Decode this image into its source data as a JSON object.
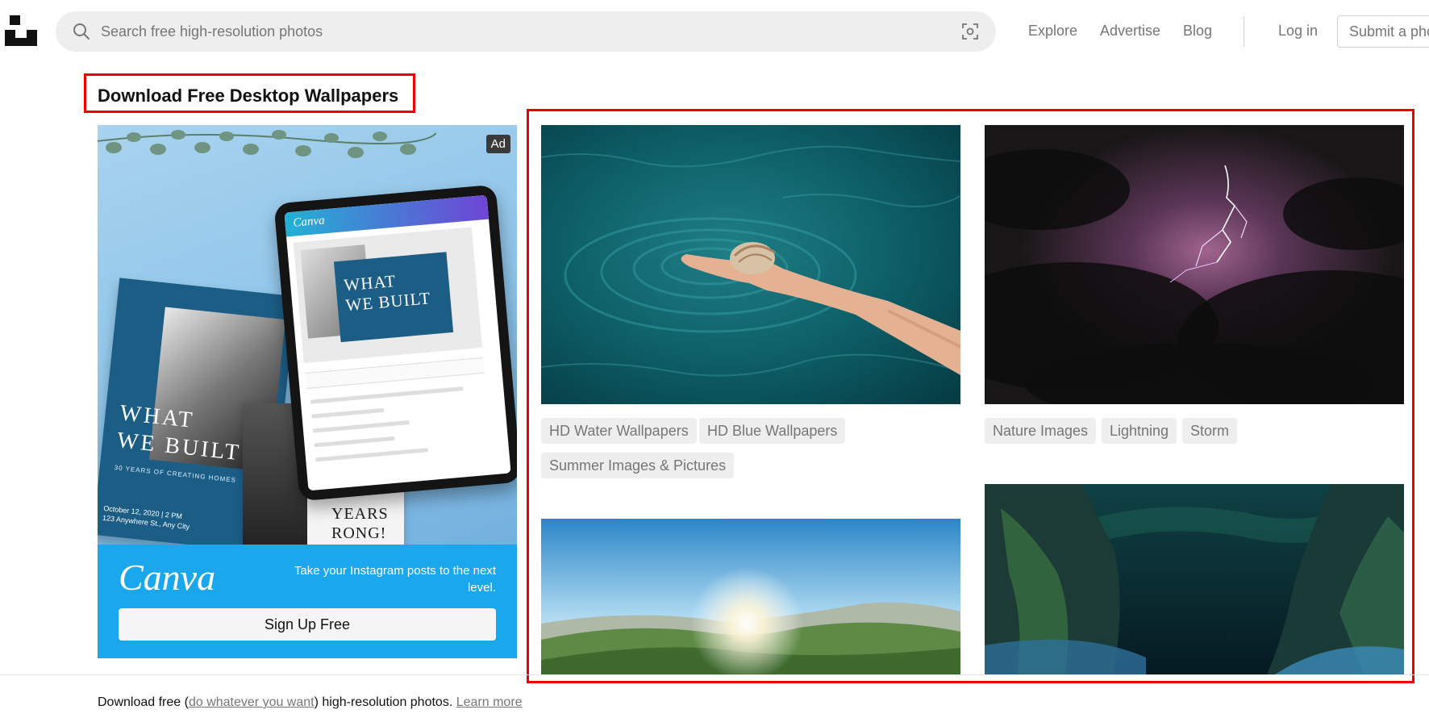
{
  "header": {
    "search_placeholder": "Search free high-resolution photos",
    "nav": {
      "explore": "Explore",
      "advertise": "Advertise",
      "blog": "Blog",
      "login": "Log in"
    },
    "submit_label": "Submit a photo"
  },
  "page_title": "Download Free Desktop Wallpapers",
  "ad": {
    "badge": "Ad",
    "poster_title_line1": "WHAT",
    "poster_title_line2": "WE BUILT",
    "poster_subtitle": "30 YEARS OF CREATING HOMES",
    "poster_date_line1": "October 12, 2020 | 2 PM",
    "poster_date_line2": "123 Anywhere St., Any City",
    "card_text_line1": "YEARS",
    "card_text_line2": "RONG!",
    "tablet_brand": "Canva",
    "tablet_box_line1": "WHAT",
    "tablet_box_line2": "WE BUILT",
    "brand": "Canva",
    "tagline": "Take your Instagram posts to the next level.",
    "cta": "Sign Up Free"
  },
  "photos": [
    {
      "name": "hand-water-seashell",
      "tags": [
        "HD Water Wallpapers",
        "HD Blue Wallpapers",
        "Summer Images & Pictures"
      ]
    },
    {
      "name": "lightning-storm",
      "tags": [
        "Nature Images",
        "Lightning",
        "Storm"
      ]
    },
    {
      "name": "sunrise-valley",
      "tags": []
    },
    {
      "name": "aurora-cliffs",
      "tags": []
    }
  ],
  "footer": {
    "prefix": "Download free (",
    "license_link": "do whatever you want",
    "middle": ") high-resolution photos. ",
    "learn_more": "Learn more"
  },
  "colors": {
    "highlight": "#ee0000",
    "ad_blue": "#1aa7ec",
    "tag_bg": "#eeeeee"
  }
}
